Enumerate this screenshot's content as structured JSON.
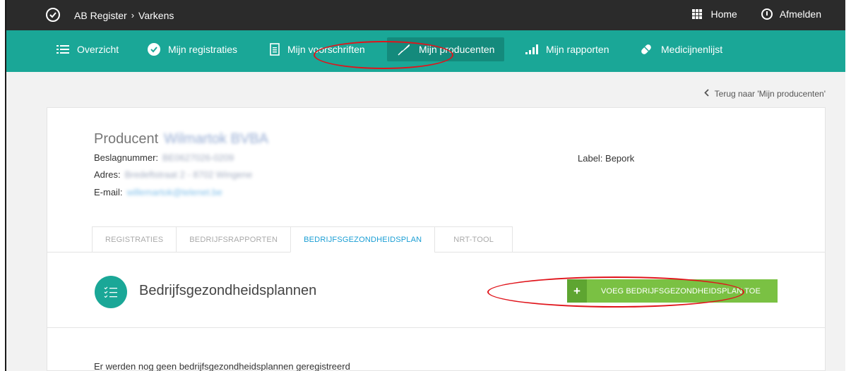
{
  "topbar": {
    "breadcrumb_root": "AB Register",
    "breadcrumb_sep": "›",
    "breadcrumb_current": "Varkens",
    "home_label": "Home",
    "logout_label": "Afmelden"
  },
  "nav": {
    "items": [
      {
        "label": "Overzicht",
        "icon": "list-icon"
      },
      {
        "label": "Mijn registraties",
        "icon": "check-circle-icon"
      },
      {
        "label": "Mijn voorschriften",
        "icon": "document-icon"
      },
      {
        "label": "Mijn producenten",
        "icon": "feather-icon",
        "active": true
      },
      {
        "label": "Mijn rapporten",
        "icon": "bar-chart-icon"
      },
      {
        "label": "Medicijnenlijst",
        "icon": "pill-icon"
      }
    ]
  },
  "back_link": "Terug naar 'Mijn producenten'",
  "producer": {
    "title_prefix": "Producent",
    "name_blurred": "Wilmartok BVBA",
    "beslag_label": "Beslagnummer:",
    "beslag_value": "BE0627026-0209",
    "adres_label": "Adres:",
    "adres_value": "Bredeftstraat 2 - 8702 Wingene",
    "email_label": "E-mail:",
    "email_value": "willemartok@telenet.be",
    "label_text": "Label: Bepork"
  },
  "tabs": [
    {
      "label": "REGISTRATIES"
    },
    {
      "label": "BEDRIJFSRAPPORTEN"
    },
    {
      "label": "BEDRIJFSGEZONDHEIDSPLAN",
      "active": true
    },
    {
      "label": "NRT-TOOL"
    }
  ],
  "plans": {
    "title": "Bedrijfsgezondheidsplannen",
    "add_button": "VOEG BEDRIJFSGEZONDHEIDSPLAN TOE",
    "add_icon": "+",
    "empty_message": "Er werden nog geen bedrijfsgezondheidsplannen geregistreerd"
  },
  "colors": {
    "nav_bg": "#1aa797",
    "topbar_bg": "#2b2b2b",
    "accent_green": "#7ac143",
    "tab_active": "#1a9ed4",
    "annotation_red": "#e0141b"
  }
}
